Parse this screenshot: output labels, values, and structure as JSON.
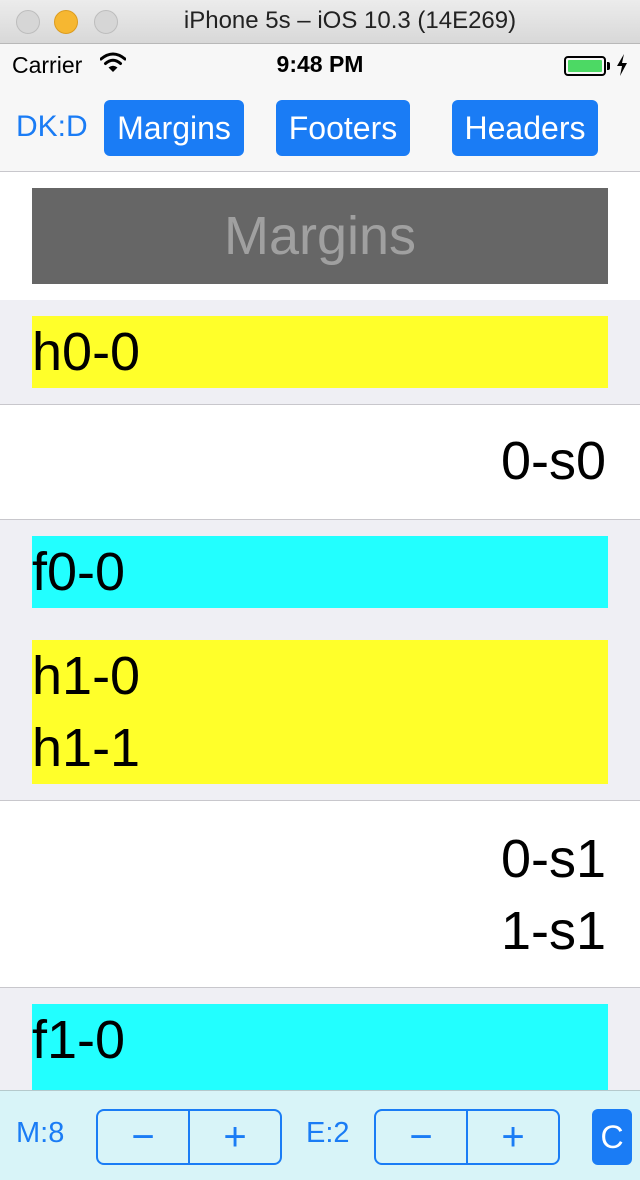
{
  "window": {
    "title": "iPhone 5s – iOS 10.3 (14E269)"
  },
  "status_bar": {
    "carrier": "Carrier",
    "time": "9:48 PM",
    "battery_level": 1.0,
    "wifi_icon": "wifi-icon",
    "charging_icon": "bolt-icon"
  },
  "nav": {
    "back_label": "DK:D",
    "buttons": [
      "Margins",
      "Footers",
      "Headers"
    ]
  },
  "table": {
    "header_title": "Margins",
    "sections": [
      {
        "header_lines": [
          "h0-0"
        ],
        "cell_lines": [
          "0-s0"
        ],
        "footer_lines": [
          "f0-0"
        ]
      },
      {
        "header_lines": [
          "h1-0",
          "h1-1"
        ],
        "cell_lines": [
          "0-s1",
          "1-s1"
        ],
        "footer_lines": [
          "f1-0"
        ]
      }
    ]
  },
  "toolbar": {
    "margin_label": "M:8",
    "extra_label": "E:2",
    "minus_symbol": "−",
    "plus_symbol": "+",
    "c_label": "C"
  },
  "colors": {
    "accent": "#1a7cf5",
    "header_bg": "#ffff2a",
    "footer_bg": "#22ffff",
    "table_header_bg": "#666666",
    "toolbar_bg": "#d8f4f8"
  }
}
